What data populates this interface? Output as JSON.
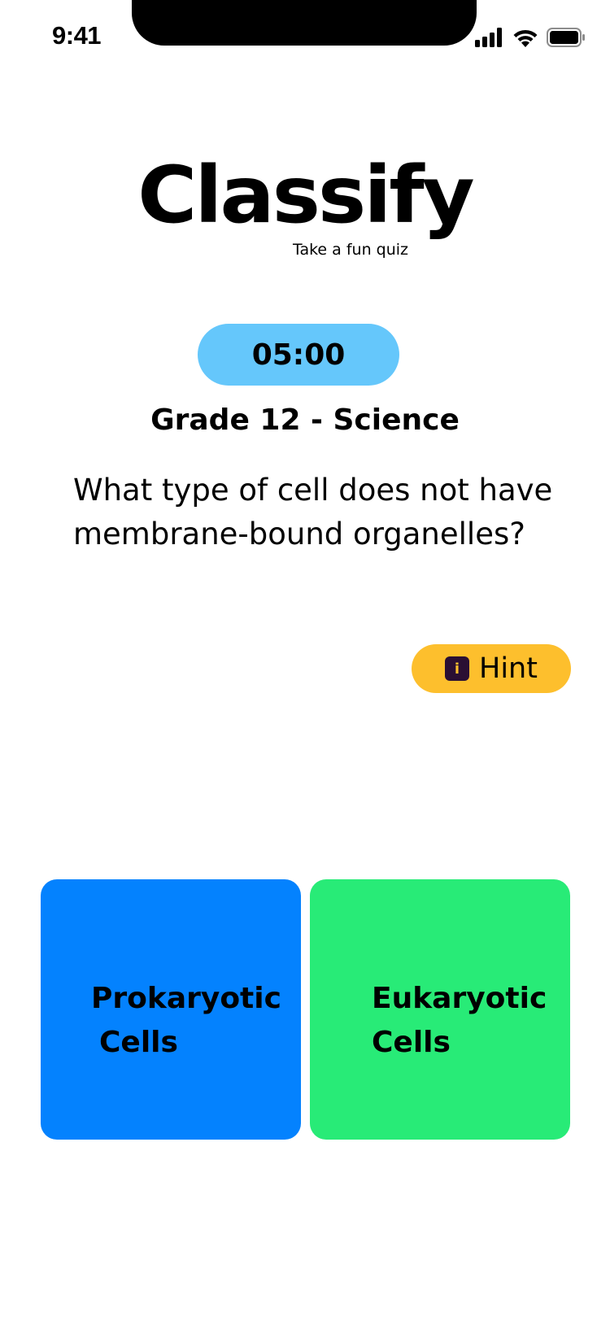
{
  "status_bar": {
    "time": "9:41"
  },
  "logo": {
    "wordmark": "Classify",
    "tagline": "Take a fun quiz"
  },
  "quiz": {
    "timer": "05:00",
    "subject": "Grade 12 - Science",
    "question": "What type of cell does not have membrane-bound organelles?"
  },
  "hint": {
    "icon": "info-icon",
    "icon_glyph": "i",
    "label": "Hint",
    "color": "#fdbf2d"
  },
  "answers": [
    {
      "line1": "Prokaryotic",
      "line2": "Cells",
      "color": "#0482fe"
    },
    {
      "line1": "Eukaryotic",
      "line2": "Cells",
      "color": "#28eb77"
    }
  ],
  "colors": {
    "timer_bg": "#65c7fb",
    "hint_bg": "#fdbf2d",
    "answer_a": "#0482fe",
    "answer_b": "#28eb77"
  }
}
